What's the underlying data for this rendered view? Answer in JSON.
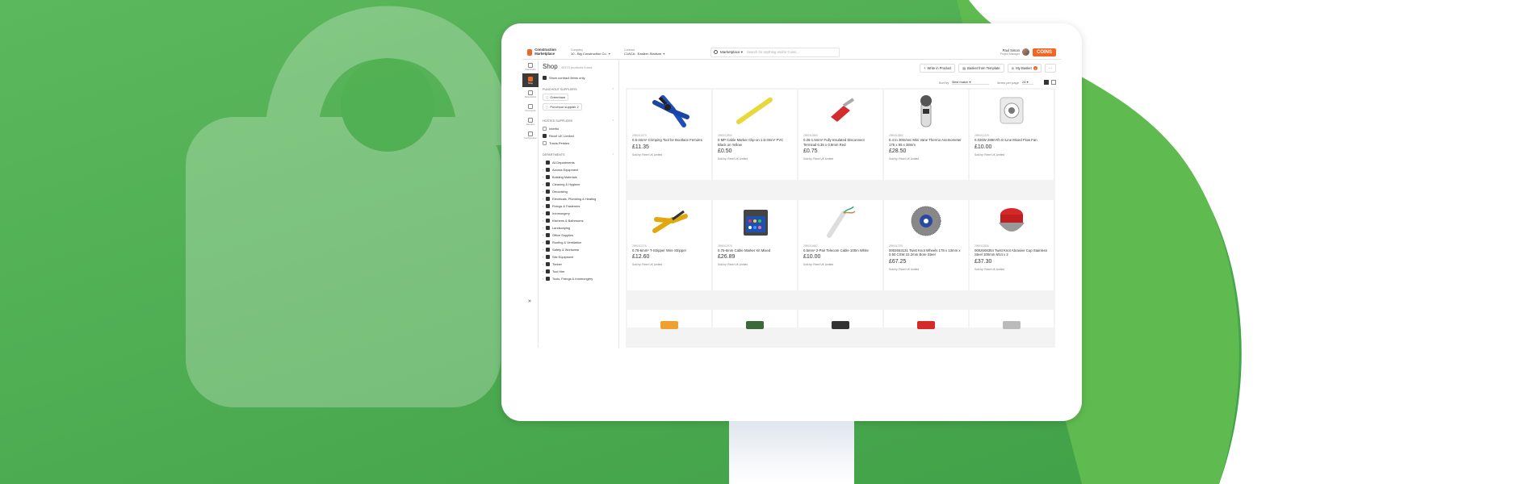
{
  "colors": {
    "brand_orange": "#f26522",
    "background_green": "#4cae4c"
  },
  "header": {
    "logo_text": "Construction Marketplace",
    "company_label": "Company",
    "company_value": "10 - Big Construction Co.",
    "contract_label": "Contract",
    "contract_value": "C1ACA - Eastern Stadium",
    "search_scope": "Marketplace",
    "search_placeholder": "Search for anything and/or Coins...",
    "user_name": "Paul Simon",
    "user_role": "Project Manager",
    "brand": "COINS"
  },
  "rail": [
    {
      "label": "Dashboard",
      "icon": "dashboard-icon"
    },
    {
      "label": "Shop",
      "icon": "shop-icon",
      "active": true
    },
    {
      "label": "Requisitions",
      "icon": "requisitions-icon"
    },
    {
      "label": "Documents",
      "icon": "documents-icon"
    },
    {
      "label": "Receipts",
      "icon": "receipts-icon"
    },
    {
      "label": "Configuration",
      "icon": "gear-icon"
    }
  ],
  "filters": {
    "title": "Shop",
    "count": "40370 products found",
    "contract_only": "Show contract items only",
    "punchout_title": "Punchout suppliers",
    "punchout": [
      "Greenham",
      "Punchout supplier 2"
    ],
    "hosted_title": "Hosted suppliers",
    "hosted": [
      {
        "label": "Interflo",
        "checked": false
      },
      {
        "label": "Rexel UK Limited",
        "checked": true
      },
      {
        "label": "Travis Perkins",
        "checked": false
      }
    ],
    "departments_title": "Departments",
    "departments": [
      "All Departments",
      "Access Equipment",
      "Building Materials",
      "Cleaning & Hygiene",
      "Decorating",
      "Electricals, Plumbing & Heating",
      "Fixings & Fasteners",
      "Ironmongery",
      "Kitchens & Bathrooms",
      "Landscaping",
      "Office Supplies",
      "Roofing & Ventilation",
      "Safety & Workwear",
      "Site Equipment",
      "Timber",
      "Tool Hire",
      "Tools, Fixings & Ironmongery"
    ]
  },
  "toolbar": {
    "write_in": "Write in Product",
    "basket_template": "Basket from Template",
    "my_basket": "My Basket",
    "basket_count": "1",
    "more": "···",
    "sort_label": "Sort by",
    "sort_value": "Best match",
    "items_label": "Items per page",
    "items_value": "24"
  },
  "products": [
    {
      "sku": "2990012270",
      "name": "0.5-4mm² Crimping Tool for Bootlace Ferrules",
      "price": "£11.35",
      "sold": "Sold by: Rexel UK Limited",
      "img": "crimper"
    },
    {
      "sku": "2990012950",
      "name": "0 MP Cable Marker Clip-on 1.5-3mm² PVC Black on Yellow",
      "price": "£0.50",
      "sold": "Sold by: Rexel UK Limited",
      "img": "marker-strip"
    },
    {
      "sku": "2990012880",
      "name": "0.25-1.5mm² Fully Insulated Disconnect Terminal 6.35 x 0.8mm Red",
      "price": "£0.75",
      "sold": "Sold by: Rexel UK Limited",
      "img": "terminal"
    },
    {
      "sku": "2990012862",
      "name": "0.4 to 30m/sec Mini Vane Thermo Anemometer 175 x 55 x 38mm",
      "price": "£28.50",
      "sold": "Sold by: Rexel UK Limited",
      "img": "anemometer"
    },
    {
      "sku": "2990012229",
      "name": "0.026W 288m³/h In-Line Mixed Flow Fan",
      "price": "£10.00",
      "sold": "Sold by: Rexel UK Limited",
      "img": "fan"
    },
    {
      "sku": "2990012276",
      "name": "0.75-6mm² T-Stripper Wire Stripper",
      "price": "£12.60",
      "sold": "Sold by: Rexel UK Limited",
      "img": "stripper"
    },
    {
      "sku": "2990012976",
      "name": "0.75-6mm Cable Marker Kit Mixed",
      "price": "£26.89",
      "sold": "Sold by: Rexel UK Limited",
      "img": "kit"
    },
    {
      "sku": "2990014657",
      "name": "0.5mm² 2-Pair Telecom Cable 100m White",
      "price": "£10.00",
      "sold": "Sold by: Rexel UK Limited",
      "img": "cable"
    },
    {
      "sku": "2990012791",
      "name": "0002653131 Twist Knot Wheels 178 x 13mm x 0.50 CSW 22.2mm Bore Steel",
      "price": "£67.25",
      "sold": "Sold by: Rexel UK Limited",
      "img": "wheel"
    },
    {
      "sku": "2990012836",
      "name": "0002608354 Twist Knot Abrasive Cup Stainless Steel 100mm M14 x 2",
      "price": "£37.30",
      "sold": "Sold by: Rexel UK Limited",
      "img": "cupbrush"
    }
  ]
}
